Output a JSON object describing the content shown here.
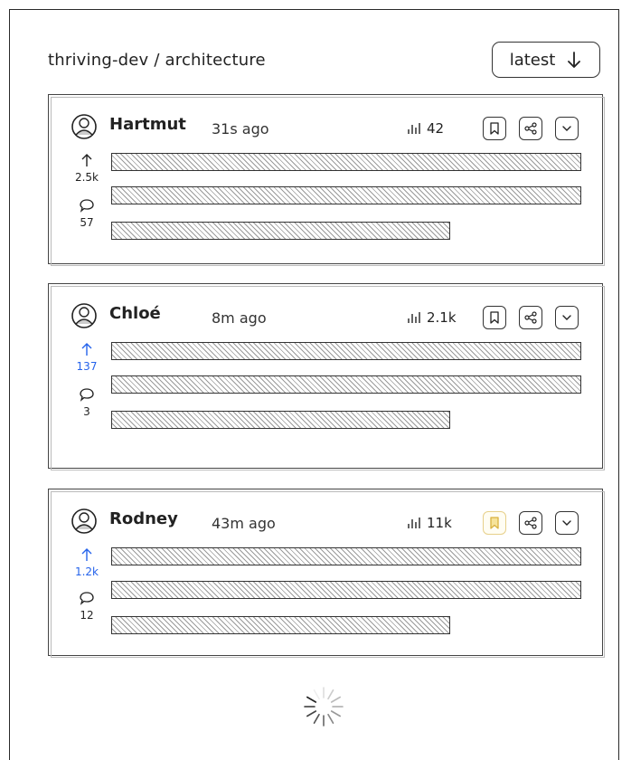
{
  "header": {
    "title": "thriving-dev / architecture",
    "sort_label": "latest"
  },
  "posts": [
    {
      "author": "Hartmut",
      "time": "31s ago",
      "views": "42",
      "votes": "2.5k",
      "comments": "57",
      "voted": false,
      "bookmarked": false
    },
    {
      "author": "Chloé",
      "time": "8m ago",
      "views": "2.1k",
      "votes": "137",
      "comments": "3",
      "voted": true,
      "bookmarked": false
    },
    {
      "author": "Rodney",
      "time": "43m ago",
      "views": "11k",
      "votes": "1.2k",
      "comments": "12",
      "voted": true,
      "bookmarked": true
    }
  ],
  "colors": {
    "accent_blue": "#2563eb",
    "bookmark_active": "#e7c35a"
  },
  "icons": [
    "user-avatar-icon",
    "bar-chart-icon",
    "bookmark-icon",
    "share-icon",
    "chevron-down-icon",
    "arrow-up-icon",
    "comment-icon",
    "arrow-down-icon",
    "loading-spinner-icon"
  ]
}
